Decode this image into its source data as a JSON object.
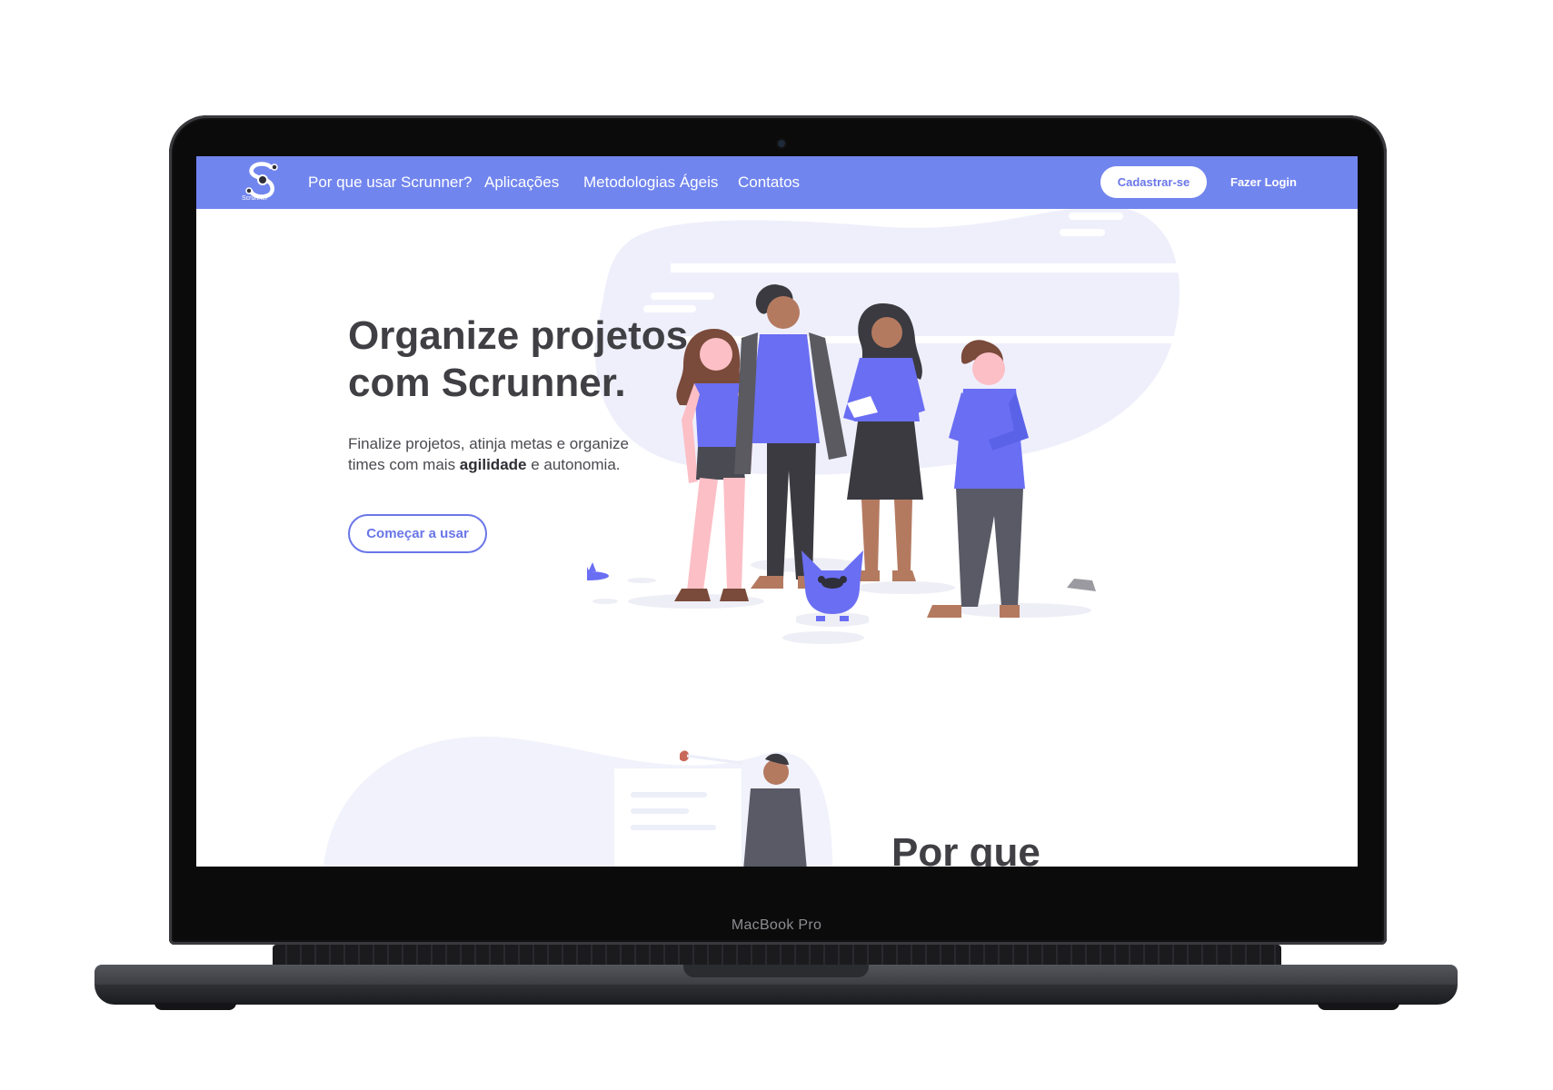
{
  "device": {
    "brand": "MacBook Pro"
  },
  "brand": {
    "logo_text": "Scrunner",
    "accent_color": "#7185ee",
    "button_text_color": "#6a76e8"
  },
  "nav": {
    "links": [
      "Por que usar Scrunner?",
      "Aplicações",
      "Metodologias Ágeis",
      "Contatos"
    ],
    "signup_label": "Cadastrar-se",
    "login_label": "Fazer Login"
  },
  "hero": {
    "title": "Organize projetos com Scrunner.",
    "text_before": "Finalize projetos, atinja metas e organize times com mais ",
    "text_bold": "agilidade",
    "text_after": " e autonomia.",
    "cta_label": "Começar a usar"
  },
  "section": {
    "title": "Por que"
  },
  "icons": [
    "scrunner-logo-icon",
    "team-illustration",
    "dog-illustration",
    "person-reading-illustration"
  ]
}
